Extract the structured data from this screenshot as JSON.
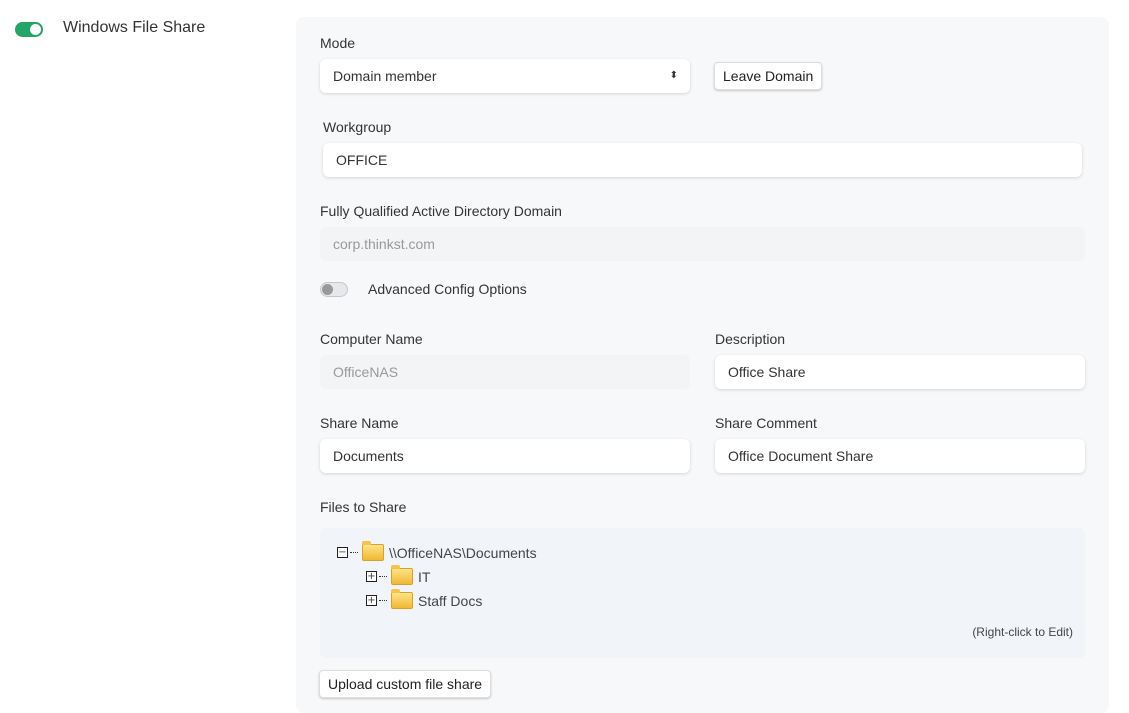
{
  "header": {
    "title": "Windows File Share",
    "enabled": true
  },
  "mode": {
    "label": "Mode",
    "value": "Domain member",
    "leave_button": "Leave Domain"
  },
  "workgroup": {
    "label": "Workgroup",
    "value": "OFFICE"
  },
  "domain": {
    "label": "Fully Qualified Active Directory Domain",
    "value": "corp.thinkst.com"
  },
  "advanced": {
    "label": "Advanced Config Options",
    "enabled": false
  },
  "computer_name": {
    "label": "Computer Name",
    "value": "OfficeNAS"
  },
  "description": {
    "label": "Description",
    "value": "Office Share"
  },
  "share_name": {
    "label": "Share Name",
    "value": "Documents"
  },
  "share_comment": {
    "label": "Share Comment",
    "value": "Office Document Share"
  },
  "files": {
    "label": "Files to Share",
    "root": "\\\\OfficeNAS\\Documents",
    "children": [
      "IT",
      "Staff Docs"
    ],
    "hint": "(Right-click to Edit)"
  },
  "upload_button": "Upload custom file share",
  "colors": {
    "accent": "#22a566",
    "toggle_off": "#c4c7cc"
  }
}
